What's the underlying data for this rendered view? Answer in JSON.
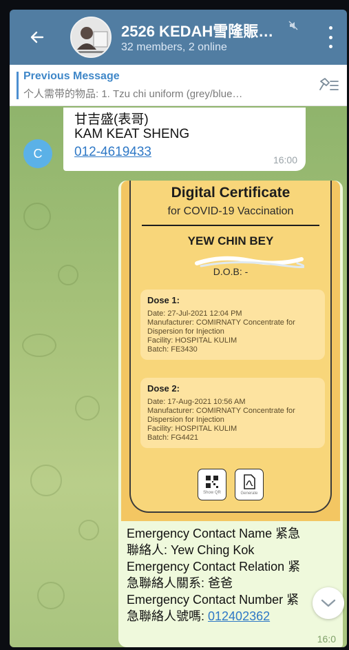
{
  "header": {
    "title": "2526 KEDAH雪隆賑…",
    "subtitle": "32 members, 2 online"
  },
  "pinned": {
    "title": "Previous Message",
    "text": "个人需带的物品: 1. Tzu chi uniform (grey/blue…"
  },
  "incoming": {
    "avatar_letter": "C",
    "line1": "甘吉盛(表哥)",
    "line2": "KAM KEAT SHENG",
    "phone": "012-4619433",
    "time": "16:00"
  },
  "certificate": {
    "title": "Digital Certificate",
    "subtitle": "for COVID-19 Vaccination",
    "name": "YEW CHIN BEY",
    "dob": "D.O.B: -",
    "doses": [
      {
        "title": "Dose 1:",
        "date": "Date: 27-Jul-2021 12:04 PM",
        "manufacturer": "Manufacturer: COMIRNATY Concentrate for",
        "manufacturer2": "Dispersion for Injection",
        "facility": "Facility: HOSPITAL KULIM",
        "batch": "Batch: FE3430"
      },
      {
        "title": "Dose 2:",
        "date": "Date: 17-Aug-2021 10:56 AM",
        "manufacturer": "Manufacturer: COMIRNATY Concentrate for",
        "manufacturer2": "Dispersion for Injection",
        "facility": "Facility: HOSPITAL KULIM",
        "batch": "Batch: FG4421"
      }
    ],
    "show_qr_label": "Show QR",
    "generate_label": "Generate"
  },
  "outgoing": {
    "line1": "Emergency Contact Name 紧急",
    "line2": "聯絡人:  Yew Ching Kok",
    "line3": "Emergency Contact Relation 紧",
    "line4": "急聯絡人關系: 爸爸",
    "line5": "Emergency Contact Number 紧",
    "line6_prefix": "急聯絡人號嗎: ",
    "phone": "012402362",
    "time": "16:0"
  },
  "colors": {
    "header_bg": "#517da2",
    "link": "#2e78c6",
    "pinned_accent": "#3f87c8",
    "bubble_out": "#eff9dc",
    "certificate_bg": "#f8d67a"
  }
}
